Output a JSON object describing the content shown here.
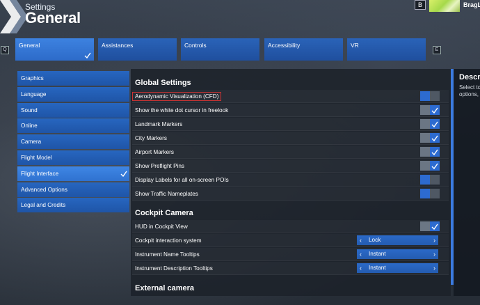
{
  "header": {
    "subtitle": "Settings",
    "title": "General",
    "key_b": "B",
    "profile_name": "BragL"
  },
  "tabs": {
    "key_left": "Q",
    "key_right": "E",
    "items": [
      {
        "label": "General",
        "active": true
      },
      {
        "label": "Assistances"
      },
      {
        "label": "Controls"
      },
      {
        "label": "Accessibility"
      },
      {
        "label": "VR"
      }
    ]
  },
  "sidebar": {
    "items": [
      {
        "label": "Graphics"
      },
      {
        "label": "Language"
      },
      {
        "label": "Sound"
      },
      {
        "label": "Online"
      },
      {
        "label": "Camera"
      },
      {
        "label": "Flight Model"
      },
      {
        "label": "Flight Interface",
        "active": true
      },
      {
        "label": "Advanced Options"
      },
      {
        "label": "Legal and Credits"
      }
    ]
  },
  "global_settings": {
    "title": "Global Settings",
    "rows": [
      {
        "label": "Aerodynamic Visualization (CFD)",
        "state": "off"
      },
      {
        "label": "Show the white dot cursor in freelook",
        "state": "on"
      },
      {
        "label": "Landmark Markers",
        "state": "on"
      },
      {
        "label": "City Markers",
        "state": "on"
      },
      {
        "label": "Airport Markers",
        "state": "on"
      },
      {
        "label": "Show Preflight Pins",
        "state": "on"
      },
      {
        "label": "Display Labels for all on-screen POIs",
        "state": "off"
      },
      {
        "label": "Show Traffic Nameplates",
        "state": "off"
      }
    ]
  },
  "cockpit_camera": {
    "title": "Cockpit Camera",
    "hud_label": "HUD in Cockpit View",
    "hud_state": "on",
    "interaction_label": "Cockpit interaction system",
    "interaction_value": "Lock",
    "name_tooltips_label": "Instrument Name Tooltips",
    "name_tooltips_value": "Instant",
    "desc_tooltips_label": "Instrument Description Tooltips",
    "desc_tooltips_value": "Instant"
  },
  "external_camera": {
    "title": "External camera"
  },
  "description": {
    "title": "Descr",
    "text_line1": "Select to",
    "text_line2": "options,"
  },
  "colors": {
    "accent": "#2d6bd0",
    "tab_bg": "#2a63b8",
    "panel_bg": "#1c222a"
  }
}
